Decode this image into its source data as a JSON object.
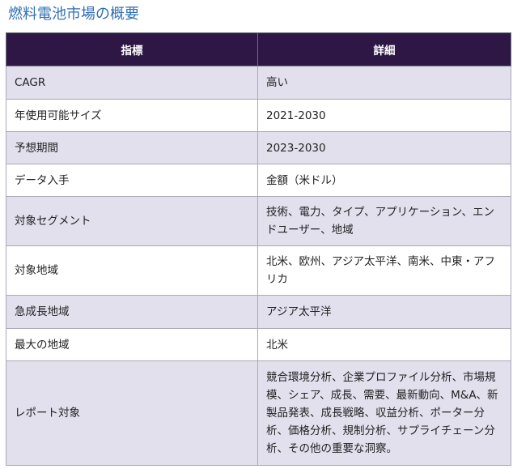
{
  "title": "燃料電池市場の概要",
  "table": {
    "headers": [
      "指標",
      "詳細"
    ],
    "rows": [
      {
        "key": "CAGR",
        "value": "高い"
      },
      {
        "key": "年使用可能サイズ",
        "value": "2021-2030"
      },
      {
        "key": "予想期間",
        "value": "2023-2030"
      },
      {
        "key": "データ入手",
        "value": "金額（米ドル）"
      },
      {
        "key": "対象セグメント",
        "value": "技術、電力、タイプ、アプリケーション、エンドユーザー、地域"
      },
      {
        "key": "対象地域",
        "value": "北米、欧州、アジア太平洋、南米、中東・アフリカ"
      },
      {
        "key": "急成長地域",
        "value": "アジア太平洋"
      },
      {
        "key": "最大の地域",
        "value": "北米"
      },
      {
        "key": "レポート対象",
        "value": "競合環境分析、企業プロファイル分析、市場規模、シェア、成長、需要、最新動向、M&A、新製品発表、成長戦略、収益分析、ポーター分析、価格分析、規制分析、サプライチェーン分析、その他の重要な洞察。"
      }
    ]
  },
  "colors": {
    "title": "#2f6fb6",
    "header_bg": "#2e1744",
    "row_shade": "#e3e0ee",
    "border": "#a9a9b8"
  }
}
